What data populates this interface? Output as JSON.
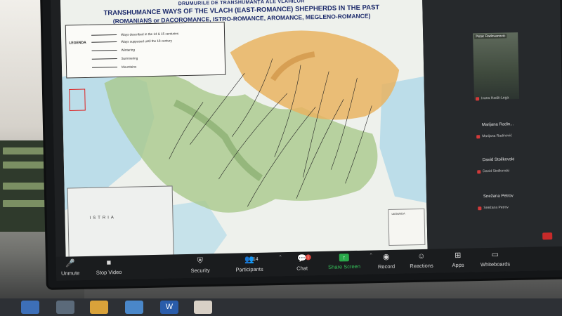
{
  "slide": {
    "title_ro": "DRUMURILE DE TRANSHUMANȚĂ ALE VLAHILOR",
    "title_en_line1": "TRANSHUMANCE WAYS OF THE VLACH (EAST-ROMANCE) SHEPHERDS IN THE PAST",
    "title_en_line2": "(ROMANIANS or DACOROMANCE, ISTRO-ROMANCE, AROMANCE, MEGLENO-ROMANCE)",
    "legend": {
      "title": "LEGENDA",
      "items": [
        "Ways described in the 14 & 15 centuries",
        "Ways supposed until the 18 century",
        "Wintering",
        "Summering",
        "Mountains"
      ]
    },
    "inset_label": "ISTRIA",
    "legend2_title": "LEGENDA"
  },
  "participants": {
    "tile_name": "Petar Radovanovic",
    "tile_sub": "Ivana Hadži-Lega",
    "list": [
      {
        "name": "Marijana Radin...",
        "sub": "Marijana Radinović"
      },
      {
        "name": "David Stoilkovski",
        "sub": "David Stoilkovski"
      },
      {
        "name": "Snežana Petrov",
        "sub": "Snežana Petrov"
      }
    ]
  },
  "toolbar": {
    "mute_label": "Unmute",
    "video_label": "Stop Video",
    "security_label": "Security",
    "participants_label": "Participants",
    "participants_count": "14",
    "chat_label": "Chat",
    "chat_badge": "1",
    "share_label": "Share Screen",
    "record_label": "Record",
    "reactions_label": "Reactions",
    "apps_label": "Apps",
    "whiteboards_label": "Whiteboards"
  },
  "colors": {
    "accent_green": "#35c15a",
    "badge_red": "#e0453c"
  }
}
